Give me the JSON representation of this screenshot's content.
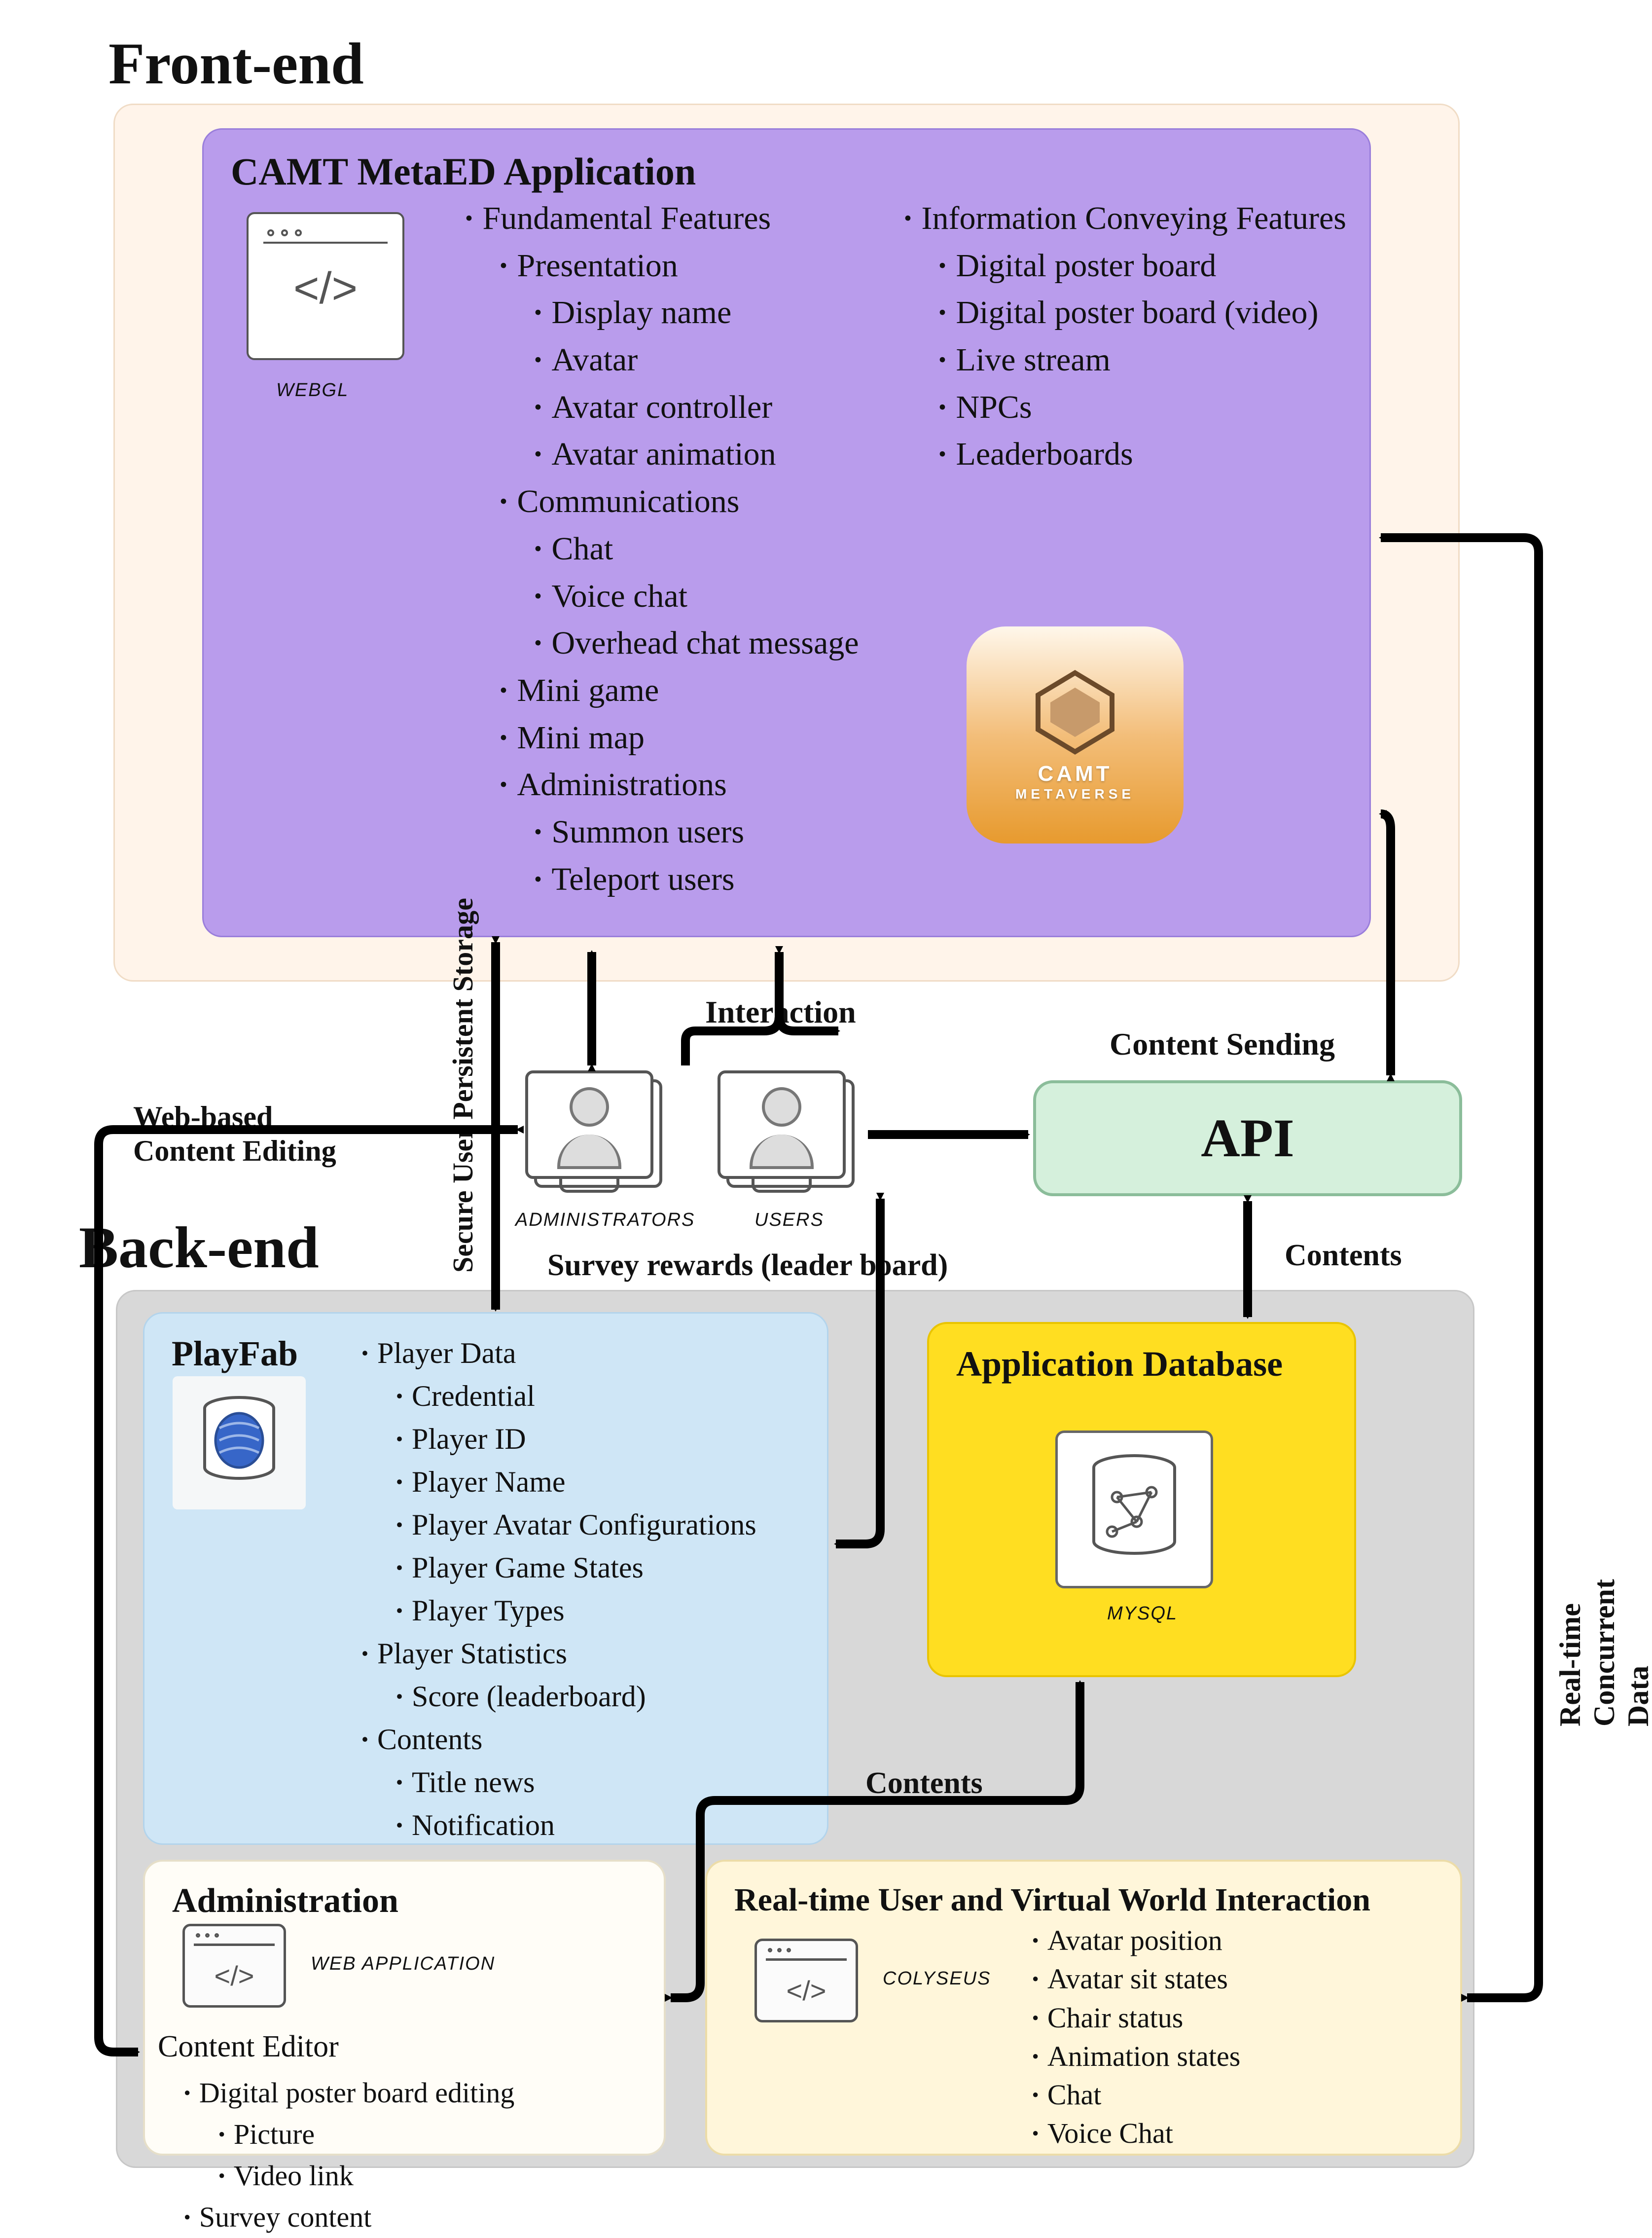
{
  "sections": {
    "frontend_label": "Front-end",
    "backend_label": "Back-end"
  },
  "metaed": {
    "title": "CAMT MetaED Application",
    "webgl_caption": "WEBGL",
    "col1_heading": "Fundamental Features",
    "presentation_heading": "Presentation",
    "presentation_items": [
      "Display name",
      "Avatar",
      "Avatar controller",
      "Avatar animation"
    ],
    "communications_heading": "Communications",
    "communications_items": [
      "Chat",
      "Voice chat",
      "Overhead chat message"
    ],
    "other_items": [
      "Mini game",
      "Mini map"
    ],
    "admin_sub_heading": "Administrations",
    "admin_sub_items": [
      "Summon users",
      "Teleport users"
    ],
    "col2_heading": "Information Conveying Features",
    "col2_items": [
      "Digital poster board",
      "Digital poster board (video)",
      "Live stream",
      "NPCs",
      "Leaderboards"
    ],
    "logo_main": "CAMT",
    "logo_sub": "METAVERSE"
  },
  "actors": {
    "admins": "ADMINISTRATORS",
    "users": "USERS"
  },
  "api": {
    "title": "API"
  },
  "arrows": {
    "interaction": "Interaction",
    "content_sending": "Content Sending",
    "secure_storage": "Secure User Persistent Storage",
    "web_editing": "Web-based\nContent Editing",
    "survey_rewards": "Survey rewards (leader board)",
    "contents_api_db": "Contents",
    "contents_admin_db": "Contents",
    "realtime_sync": "Real-time Concurrent  Data Synchronisation"
  },
  "playfab": {
    "title": "PlayFab",
    "player_data_heading": "Player Data",
    "player_data_items": [
      "Credential",
      "Player ID",
      "Player Name",
      "Player Avatar Configurations",
      "Player Game States",
      "Player Types"
    ],
    "player_stats_heading": "Player Statistics",
    "player_stats_items": [
      "Score (leaderboard)"
    ],
    "contents_heading": "Contents",
    "contents_items": [
      "Title news",
      "Notification"
    ]
  },
  "appdb": {
    "title": "Application Database",
    "caption": "MYSQL"
  },
  "admin_panel": {
    "title": "Administration",
    "caption": "WEB APPLICATION",
    "editor_heading": "Content Editor",
    "poster_heading": "Digital poster board editing",
    "poster_items": [
      "Picture",
      "Video link"
    ],
    "survey_item": "Survey content"
  },
  "realtime_box": {
    "title": "Real-time User and Virtual World Interaction",
    "caption": "COLYSEUS",
    "items": [
      "Avatar position",
      "Avatar sit states",
      "Chair status",
      "Animation states",
      "Chat",
      "Voice Chat"
    ]
  }
}
